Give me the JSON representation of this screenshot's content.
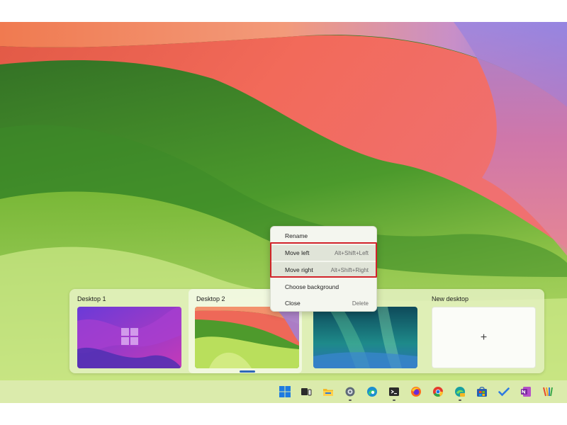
{
  "desktops": [
    {
      "label": "Desktop 1"
    },
    {
      "label": "Desktop 2"
    },
    {
      "label": ""
    },
    {
      "label": "New desktop",
      "action": "+"
    }
  ],
  "context_menu": {
    "items": [
      {
        "label": "Rename",
        "shortcut": ""
      },
      {
        "label": "Move left",
        "shortcut": "Alt+Shift+Left"
      },
      {
        "label": "Move right",
        "shortcut": "Alt+Shift+Right"
      },
      {
        "label": "Choose background",
        "shortcut": ""
      },
      {
        "label": "Close",
        "shortcut": "Delete"
      }
    ],
    "highlighted_items": [
      "Move left",
      "Move right"
    ],
    "highlight_color": "#d2232a"
  },
  "taskbar": {
    "icons": [
      "windows-start-icon",
      "task-view-icon",
      "file-explorer-icon",
      "settings-icon",
      "edge-icon",
      "terminal-icon",
      "firefox-icon",
      "chrome-icon",
      "edge-canary-icon",
      "microsoft-store-icon",
      "todo-icon",
      "onenote-icon",
      "app-icon"
    ],
    "running_indicator_color": "#555555"
  },
  "colors": {
    "accent": "#2f67b8",
    "wallpaper_green": "#3c7a2c",
    "wallpaper_coral": "#f06a5c"
  }
}
